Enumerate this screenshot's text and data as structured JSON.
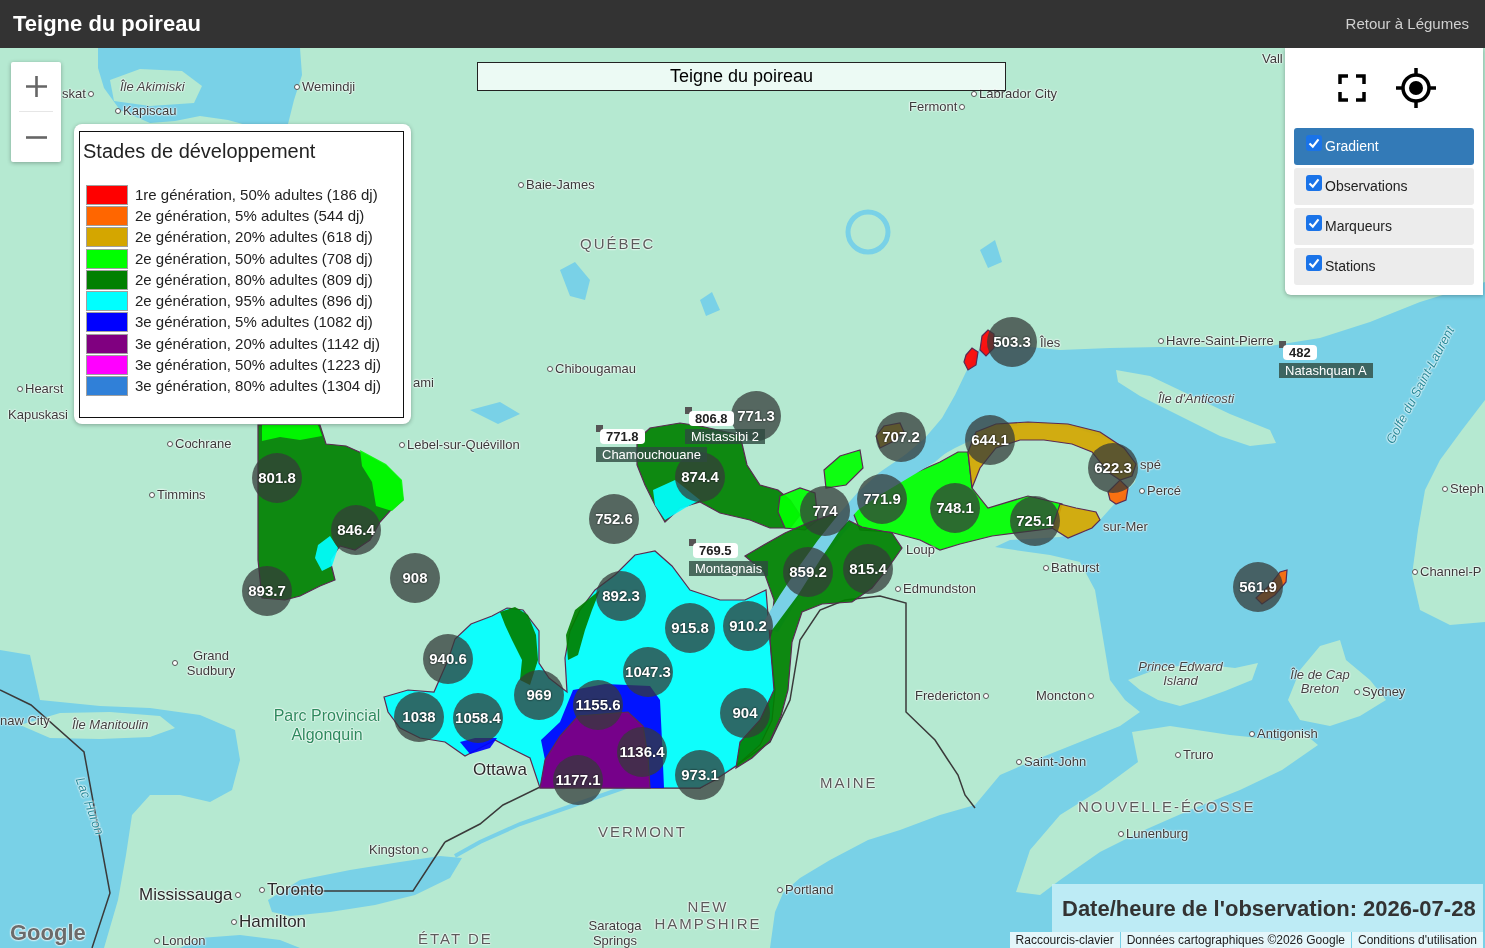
{
  "header": {
    "title": "Teigne du poireau",
    "link": "Retour à Légumes"
  },
  "map": {
    "title": "Teigne du poireau",
    "legend": {
      "title": "Stades de développement",
      "items": [
        {
          "label": "1re génération, 50% adultes (186 dj)",
          "color": "#ff0000"
        },
        {
          "label": "2e génération, 5% adultes (544 dj)",
          "color": "#ff6600"
        },
        {
          "label": "2e génération, 20% adultes (618 dj)",
          "color": "#d4a600"
        },
        {
          "label": "2e génération, 50% adultes (708 dj)",
          "color": "#00ff00"
        },
        {
          "label": "2e génération, 80% adultes (809 dj)",
          "color": "#008000"
        },
        {
          "label": "2e génération, 95% adultes (896 dj)",
          "color": "#00ffff"
        },
        {
          "label": "3e génération, 5% adultes (1082 dj)",
          "color": "#0000ff"
        },
        {
          "label": "3e génération, 20% adultes (1142 dj)",
          "color": "#800080"
        },
        {
          "label": "3e génération, 50% adultes (1223 dj)",
          "color": "#ff00ff"
        },
        {
          "label": "3e génération, 80% adultes (1304 dj)",
          "color": "#3080d8"
        }
      ]
    },
    "layers": [
      {
        "label": "Gradient",
        "checked": true,
        "selected": true
      },
      {
        "label": "Observations",
        "checked": true,
        "selected": false
      },
      {
        "label": "Marqueurs",
        "checked": true,
        "selected": false
      },
      {
        "label": "Stations",
        "checked": true,
        "selected": false
      }
    ],
    "labels": [
      {
        "text": "Vall",
        "kind": "city"
      },
      {
        "text": "skat",
        "kind": "city"
      },
      {
        "text": "Île Akimiski",
        "kind": "island"
      },
      {
        "text": "Wemindji",
        "kind": "city"
      },
      {
        "text": "Labrador City",
        "kind": "city"
      },
      {
        "text": "Kapiscau",
        "kind": "city"
      },
      {
        "text": "Fermont",
        "kind": "city"
      },
      {
        "text": "Baie-James",
        "kind": "city"
      },
      {
        "text": "QUÉBEC",
        "kind": "region"
      },
      {
        "text": "Îles",
        "kind": "city"
      },
      {
        "text": "Havre-Saint-Pierre",
        "kind": "city"
      },
      {
        "text": "Chibougamau",
        "kind": "city"
      },
      {
        "text": "Hearst",
        "kind": "city"
      },
      {
        "text": "ami",
        "kind": "city"
      },
      {
        "text": "Île d'Anticosti",
        "kind": "island"
      },
      {
        "text": "Kapuskasi",
        "kind": "city"
      },
      {
        "text": "Cochrane",
        "kind": "city"
      },
      {
        "text": "Lebel-sur-Quévillon",
        "kind": "city"
      },
      {
        "text": "Golfe du Saint-Laurent",
        "kind": "water"
      },
      {
        "text": "spé",
        "kind": "city"
      },
      {
        "text": "Timmins",
        "kind": "city"
      },
      {
        "text": "Percé",
        "kind": "city"
      },
      {
        "text": "Steph",
        "kind": "city"
      },
      {
        "text": "sur-Mer",
        "kind": "city"
      },
      {
        "text": "Loup",
        "kind": "city"
      },
      {
        "text": "Bathurst",
        "kind": "city"
      },
      {
        "text": "Channel-P",
        "kind": "city"
      },
      {
        "text": "Edmundston",
        "kind": "city"
      },
      {
        "text": "Grand Sudbury",
        "kind": "city"
      },
      {
        "text": "Prince Edward Island",
        "kind": "island"
      },
      {
        "text": "Fredericton",
        "kind": "city"
      },
      {
        "text": "Moncton",
        "kind": "city"
      },
      {
        "text": "Île de Cap Breton",
        "kind": "island"
      },
      {
        "text": "Sydney",
        "kind": "city"
      },
      {
        "text": "naw City",
        "kind": "city"
      },
      {
        "text": "Île Manitoulin",
        "kind": "island"
      },
      {
        "text": "Parc Provincial Algonquin",
        "kind": "park"
      },
      {
        "text": "Antigonish",
        "kind": "city"
      },
      {
        "text": "Ottawa",
        "kind": "metro"
      },
      {
        "text": "Saint-John",
        "kind": "city"
      },
      {
        "text": "Truro",
        "kind": "city"
      },
      {
        "text": "Lac Huron",
        "kind": "water"
      },
      {
        "text": "MAINE",
        "kind": "region"
      },
      {
        "text": "NOUVELLE-ÉCOSSE",
        "kind": "region"
      },
      {
        "text": "VERMONT",
        "kind": "region"
      },
      {
        "text": "Lunenburg",
        "kind": "city"
      },
      {
        "text": "Kingston",
        "kind": "city"
      },
      {
        "text": "Mississauga",
        "kind": "metro"
      },
      {
        "text": "Toronto",
        "kind": "metro"
      },
      {
        "text": "Portland",
        "kind": "city"
      },
      {
        "text": "Hamilton",
        "kind": "metro"
      },
      {
        "text": "ÉTAT DE",
        "kind": "region"
      },
      {
        "text": "Saratoga Springs",
        "kind": "city"
      },
      {
        "text": "NEW HAMPSHIRE",
        "kind": "region"
      },
      {
        "text": "London",
        "kind": "city"
      }
    ],
    "stations": [
      {
        "value": "482",
        "name": "Natashquan A"
      },
      {
        "value": "806.8",
        "name": "Mistassibi 2"
      },
      {
        "value": "771.8",
        "name": "Chamouchouane"
      },
      {
        "value": "769.5",
        "name": "Montagnais"
      }
    ],
    "markers": [
      "503.3",
      "771.3",
      "707.2",
      "644.1",
      "801.8",
      "874.4",
      "622.3",
      "846.4",
      "752.6",
      "774",
      "771.9",
      "748.1",
      "725.1",
      "893.7",
      "908",
      "892.3",
      "859.2",
      "815.4",
      "561.9",
      "915.8",
      "910.2",
      "940.6",
      "1047.3",
      "1038",
      "1058.4",
      "969",
      "1155.6",
      "904",
      "1136.4",
      "1177.1",
      "973.1"
    ],
    "observation_date": "Date/heure de l'observation: 2026-07-28",
    "logo": "Google",
    "attribution": [
      "Raccourcis-clavier",
      "Données cartographiques ©2026 Google",
      "Conditions d'utilisation"
    ]
  }
}
